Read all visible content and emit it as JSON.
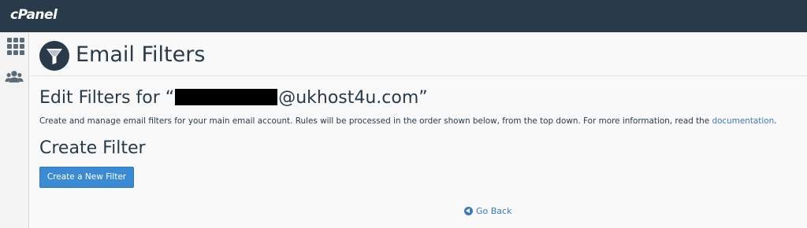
{
  "topbar": {
    "logo_text": "cPanel",
    "bg_color": "#293a4a"
  },
  "sidebar": {
    "icons": [
      "grid-icon",
      "users-icon"
    ]
  },
  "header": {
    "title": "Email Filters",
    "icon": "funnel-icon"
  },
  "edit": {
    "prefix": "Edit Filters for “",
    "suffix": "@ukhost4u.com”",
    "description": "Create and manage email filters for your main email account. Rules will be processed in the order shown below, from the top down. For more information, read the ",
    "doc_link": "documentation",
    "description_end": "."
  },
  "create": {
    "heading": "Create Filter",
    "button_label": "Create a New Filter",
    "button_color": "#3a8ad4"
  },
  "footer": {
    "go_back_label": "Go Back",
    "link_color": "#3a7bbd"
  }
}
